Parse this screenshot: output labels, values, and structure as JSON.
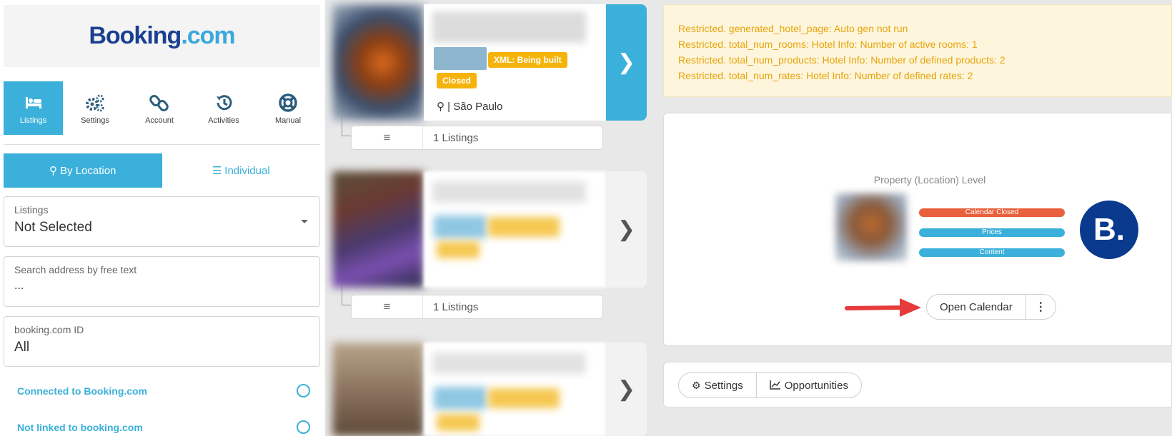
{
  "brand": {
    "name": "Booking",
    "tld": ".com"
  },
  "nav": [
    {
      "label": "Listings",
      "icon": "bed-icon",
      "active": true
    },
    {
      "label": "Settings",
      "icon": "gears-icon",
      "active": false
    },
    {
      "label": "Account",
      "icon": "link-icon",
      "active": false
    },
    {
      "label": "Activities",
      "icon": "history-icon",
      "active": false
    },
    {
      "label": "Manual",
      "icon": "lifebuoy-icon",
      "active": false
    }
  ],
  "view_toggle": {
    "by_location": "By Location",
    "individual": "Individual"
  },
  "filters": {
    "listings": {
      "label": "Listings",
      "value": "Not Selected"
    },
    "search": {
      "label": "Search address by free text",
      "value": "..."
    },
    "booking_id": {
      "label": "booking.com ID",
      "value": "All"
    }
  },
  "status_filters": [
    {
      "label": "Connected to Booking.com"
    },
    {
      "label": "Not linked to booking.com"
    }
  ],
  "cards": [
    {
      "badge_xml": "XML: Being built",
      "badge_closed": "Closed",
      "city": "| São Paulo",
      "listings": "1 Listings",
      "active": true
    },
    {
      "listings": "1 Listings",
      "active": false
    },
    {
      "active": false
    }
  ],
  "warnings": [
    "Restricted. generated_hotel_page: Auto gen not run",
    "Restricted. total_num_rooms: Hotel Info: Number of active rooms: 1",
    "Restricted. total_num_products: Hotel Info: Number of defined products: 2",
    "Restricted. total_num_rates: Hotel Info: Number of defined rates: 2"
  ],
  "property": {
    "level_label": "Property (Location) Level",
    "bars": [
      {
        "label": "Calendar Closed",
        "color": "#e9603c"
      },
      {
        "label": "Prices",
        "color": "#3ab0da"
      },
      {
        "label": "Content",
        "color": "#3ab0da"
      }
    ],
    "badge": "B.",
    "open_calendar": "Open Calendar",
    "more": "⋮"
  },
  "bottom": {
    "settings": "Settings",
    "opportunities": "Opportunities"
  },
  "colors": {
    "accent": "#3ab0da",
    "warn_text": "#e8a30c",
    "badge": "#f5b40c",
    "brand_dark": "#0a3a8e"
  }
}
